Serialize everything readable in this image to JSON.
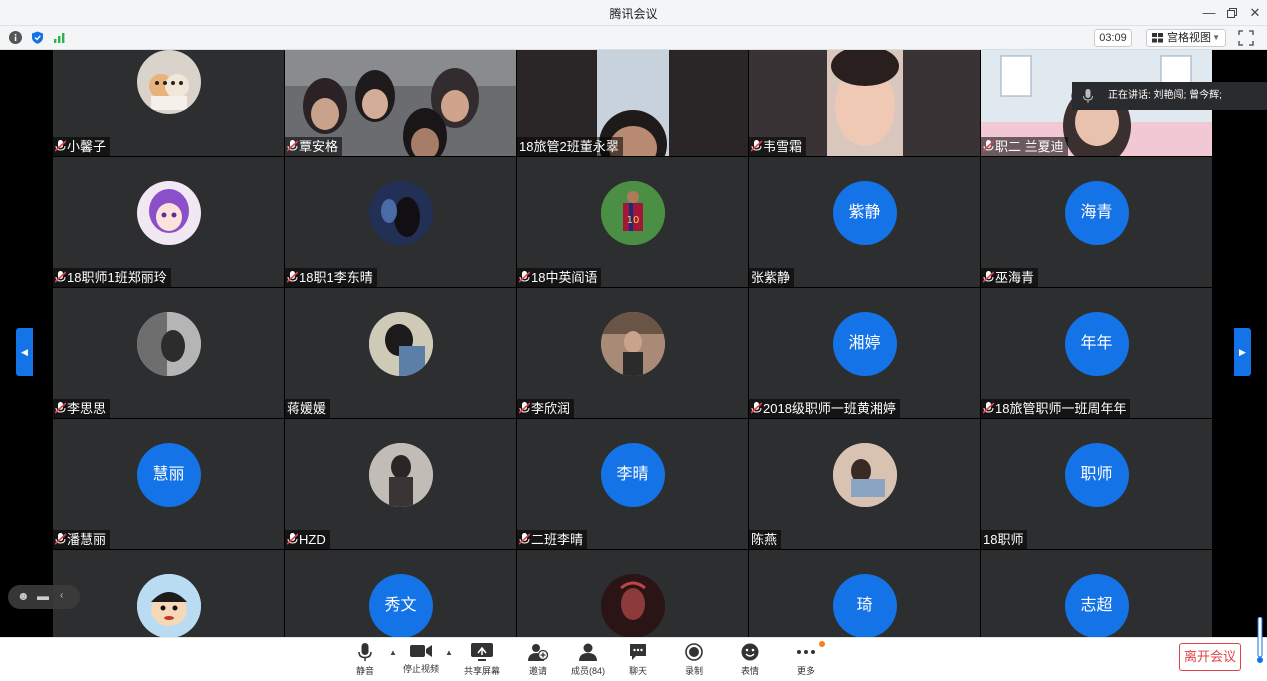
{
  "window": {
    "title": "腾讯会议"
  },
  "status": {
    "timer": "03:09",
    "view_mode": "宫格视图"
  },
  "speaking": {
    "text": "正在讲话: 刘艳闯; 曾今辉;"
  },
  "participants": [
    {
      "name": "小馨子",
      "muted": true
    },
    {
      "name": "覃安格",
      "muted": true
    },
    {
      "name": "18旅管2班董永翠",
      "muted": false
    },
    {
      "name": "韦雪霜",
      "muted": true
    },
    {
      "name": "职二 兰夏迪",
      "muted": true
    },
    {
      "name": "18职师1班郑丽玲",
      "muted": true
    },
    {
      "name": "18职1李东晴",
      "muted": true
    },
    {
      "name": "18中英阎语",
      "muted": true
    },
    {
      "name": "张紫静",
      "muted": false,
      "avatar_text": "紫静"
    },
    {
      "name": "巫海青",
      "muted": true,
      "avatar_text": "海青"
    },
    {
      "name": "李思思",
      "muted": true
    },
    {
      "name": "蒋媛媛",
      "muted": false
    },
    {
      "name": "李欣润",
      "muted": true
    },
    {
      "name": "2018级职师一班黄湘婷",
      "muted": true,
      "avatar_text": "湘婷"
    },
    {
      "name": "18旅管职师一班周年年",
      "muted": true,
      "avatar_text": "年年"
    },
    {
      "name": "潘慧丽",
      "muted": true,
      "avatar_text": "慧丽"
    },
    {
      "name": "HZD",
      "muted": true
    },
    {
      "name": "二班李晴",
      "muted": true,
      "avatar_text": "李晴"
    },
    {
      "name": "陈燕",
      "muted": false
    },
    {
      "name": "18职师",
      "muted": false,
      "avatar_text": "职师"
    },
    {
      "name": "",
      "muted": false
    },
    {
      "name": "",
      "muted": false,
      "avatar_text": "秀文"
    },
    {
      "name": "",
      "muted": false
    },
    {
      "name": "",
      "muted": false,
      "avatar_text": "琦"
    },
    {
      "name": "",
      "muted": false,
      "avatar_text": "志超"
    }
  ],
  "toolbar": {
    "mute": "静音",
    "stop_video": "停止视频",
    "share_screen": "共享屏幕",
    "invite": "邀请",
    "members": "成员(84)",
    "chat": "聊天",
    "record": "录制",
    "reactions": "表情",
    "more": "更多",
    "leave": "离开会议"
  },
  "colors": {
    "accent": "#1473e6",
    "leave": "#e0424a",
    "tile": "#2d2e30"
  }
}
